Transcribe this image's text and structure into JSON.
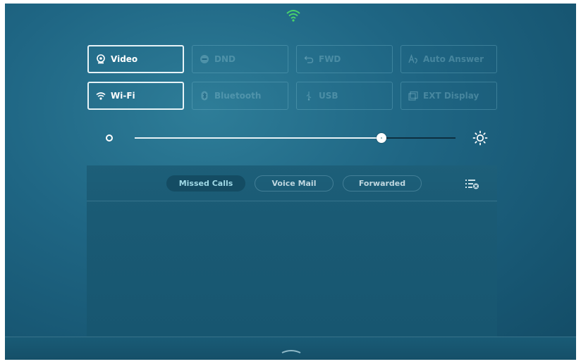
{
  "status": {
    "wifi_icon": "wifi-icon"
  },
  "quick_settings": [
    {
      "label": "Video",
      "icon": "camera-icon",
      "active": true
    },
    {
      "label": "DND",
      "icon": "dnd-icon",
      "active": false
    },
    {
      "label": "FWD",
      "icon": "forward-icon",
      "active": false
    },
    {
      "label": "Auto Answer",
      "icon": "auto-answer-icon",
      "active": false
    },
    {
      "label": "Wi-Fi",
      "icon": "wifi-icon",
      "active": true
    },
    {
      "label": "Bluetooth",
      "icon": "bluetooth-icon",
      "active": false
    },
    {
      "label": "USB",
      "icon": "usb-icon",
      "active": false
    },
    {
      "label": "EXT Display",
      "icon": "display-icon",
      "active": false
    }
  ],
  "brightness": {
    "level": 0.77,
    "low_icon": "brightness-low-icon",
    "high_icon": "brightness-high-icon"
  },
  "notifications": {
    "tabs": [
      {
        "label": "Missed Calls",
        "active": true
      },
      {
        "label": "Voice Mail",
        "active": false
      },
      {
        "label": "Forwarded",
        "active": false
      }
    ],
    "clear_icon": "clear-list-icon"
  },
  "colors": {
    "background": "#1f6684",
    "active_border": "#e6f3f7",
    "active_tab_text": "#9fd9e6"
  }
}
